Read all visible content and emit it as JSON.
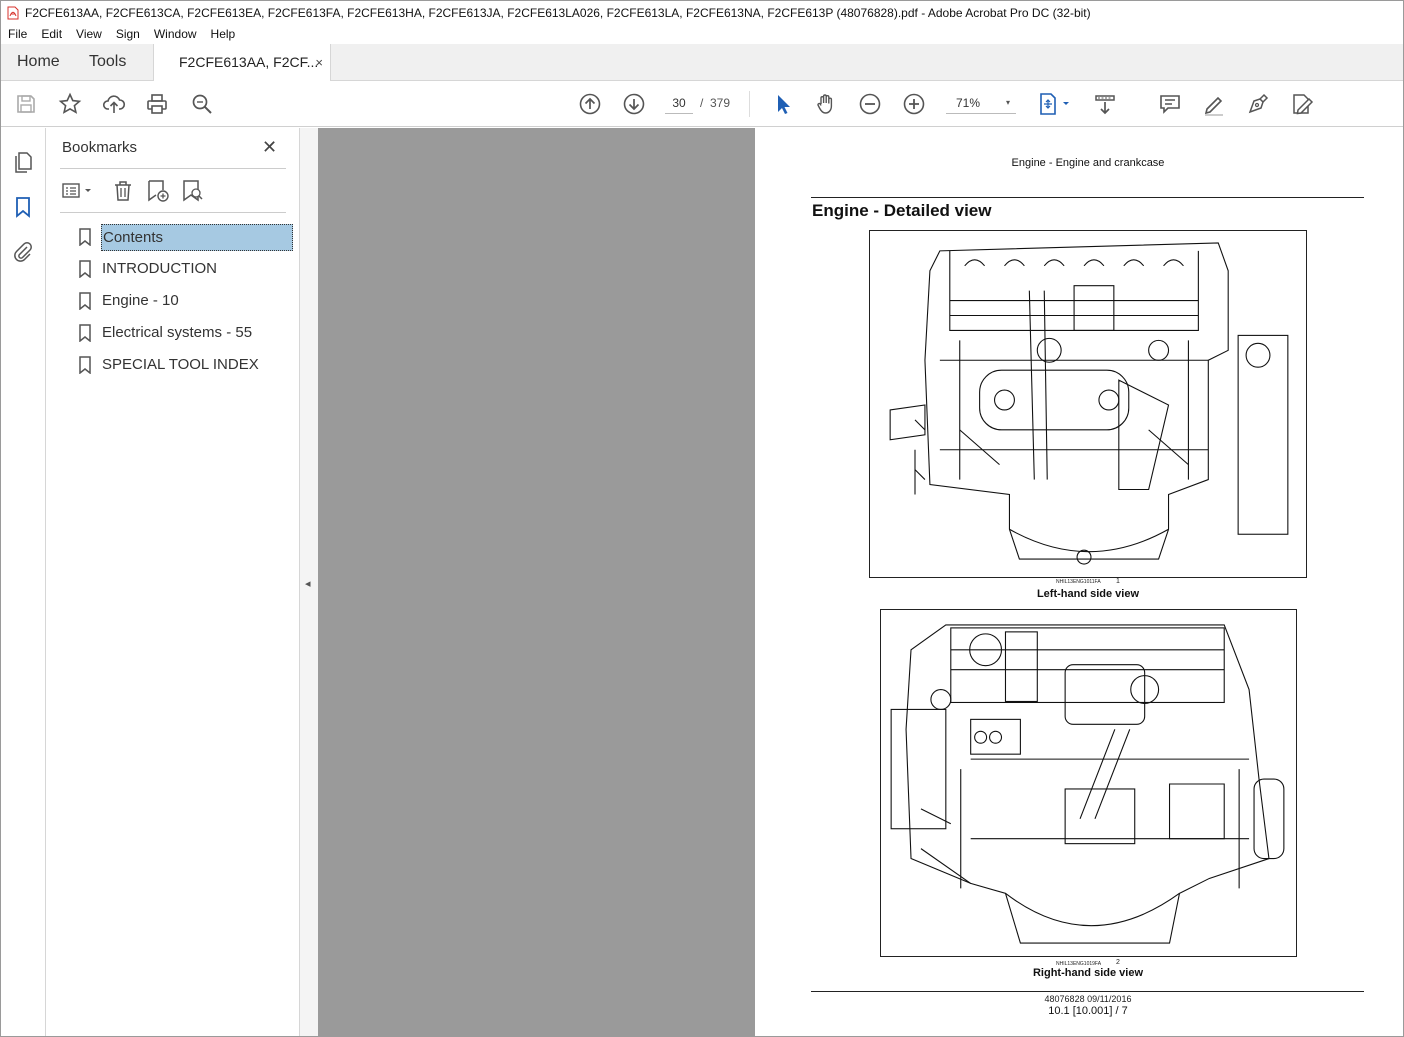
{
  "window": {
    "title": "F2CFE613AA, F2CFE613CA, F2CFE613EA, F2CFE613FA, F2CFE613HA, F2CFE613JA, F2CFE613LA026, F2CFE613LA, F2CFE613NA, F2CFE613P (48076828).pdf - Adobe Acrobat Pro DC (32-bit)"
  },
  "menu": [
    "File",
    "Edit",
    "View",
    "Sign",
    "Window",
    "Help"
  ],
  "tabs": {
    "home": "Home",
    "tools": "Tools",
    "document": "F2CFE613AA, F2CF...",
    "close": "×"
  },
  "toolbar": {
    "current_page": "30",
    "separator": "/",
    "total_pages": "379",
    "zoom": "71%",
    "zoom_caret": "▾"
  },
  "bookmarks": {
    "title": "Bookmarks",
    "close": "✕",
    "items": [
      {
        "label": "Contents",
        "selected": true
      },
      {
        "label": "INTRODUCTION"
      },
      {
        "label": "Engine - 10"
      },
      {
        "label": "Electrical systems - 55"
      },
      {
        "label": "SPECIAL TOOL INDEX"
      }
    ]
  },
  "collapse_arrow": "◂",
  "page": {
    "header": "Engine - Engine and crankcase",
    "heading": "Engine - Detailed view",
    "figures": [
      {
        "code": "NHIL13ENG1011FA",
        "number": "1",
        "caption": "Left-hand side view"
      },
      {
        "code": "NHIL13ENG1019FA",
        "number": "2",
        "caption": "Right-hand side view"
      }
    ],
    "footer_ref": "48076828 09/11/2016",
    "footer_page": "10.1 [10.001] / 7"
  },
  "colors": {
    "selected_bookmark": "#a6c9e2",
    "doc_background": "#9a9a9a",
    "select_tool": "#1f5fb4",
    "acrobat_red": "#d7322b"
  }
}
